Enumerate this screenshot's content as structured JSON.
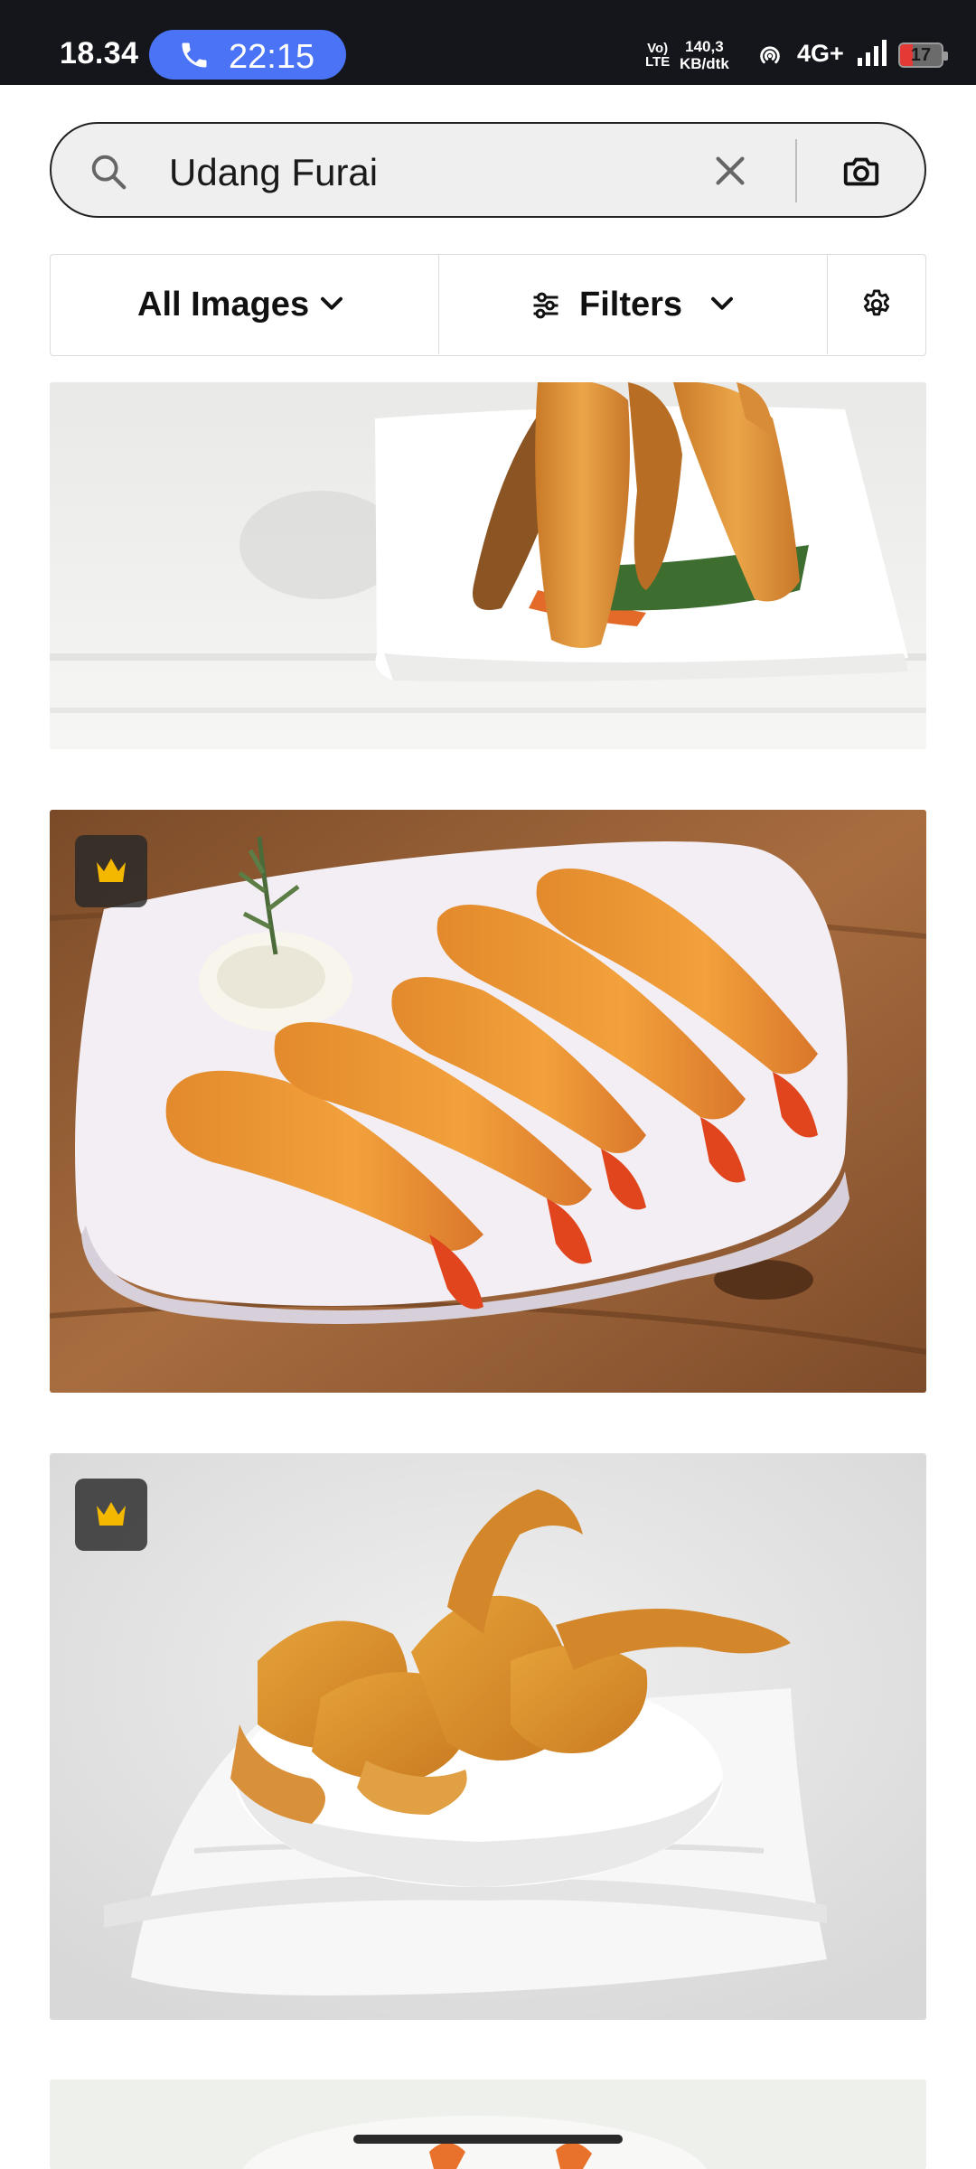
{
  "status_bar": {
    "time": "18.34",
    "call_duration": "22:15",
    "volte_line1": "Vo)",
    "volte_line2": "LTE",
    "net_speed_value": "140,3",
    "net_speed_unit": "KB/dtk",
    "network_type": "4G+",
    "battery": "17",
    "icons": [
      "phone-icon",
      "hotspot-icon",
      "signal-icon",
      "battery-icon"
    ]
  },
  "search": {
    "query": "Udang Furai",
    "icons": [
      "search-icon",
      "clear-icon",
      "camera-icon"
    ]
  },
  "filter_bar": {
    "all_images_label": "All Images",
    "filters_label": "Filters",
    "icons": [
      "chevron-down-icon",
      "tune-icon",
      "gear-icon"
    ]
  },
  "results": [
    {
      "premium": false
    },
    {
      "premium": true
    },
    {
      "premium": true
    },
    {
      "premium": false
    }
  ],
  "colors": {
    "status_bar_bg": "#15161c",
    "call_pill": "#4b73f5",
    "premium_crown": "#f5b800"
  }
}
